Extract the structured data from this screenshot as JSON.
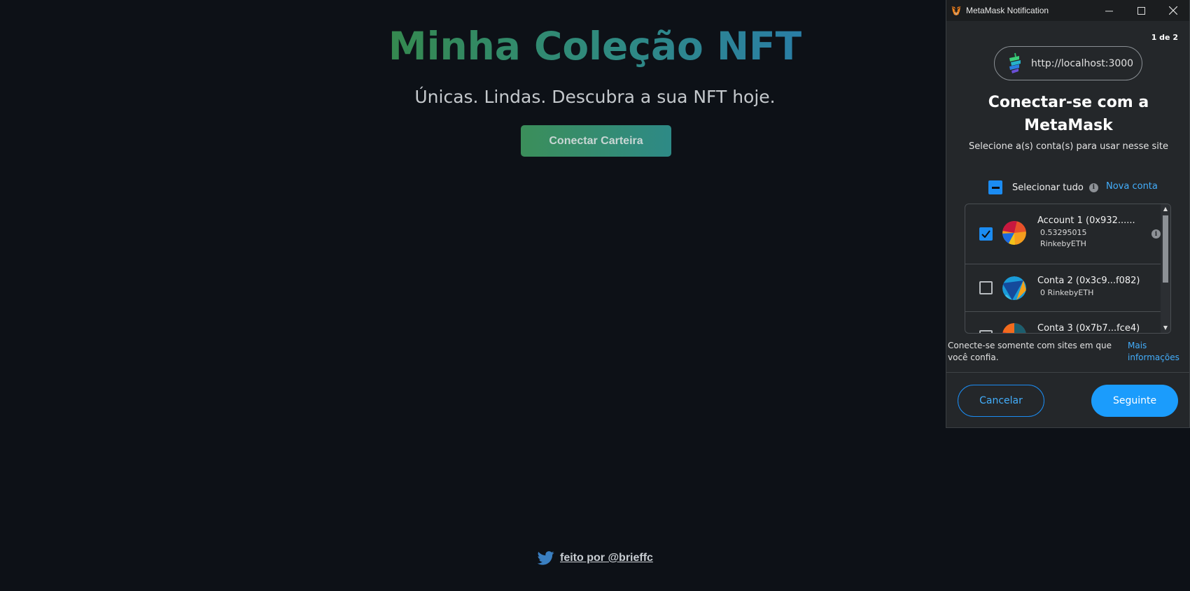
{
  "page": {
    "title": "Minha Coleção NFT",
    "subtitle": "Únicas. Lindas. Descubra a sua NFT hoje.",
    "connect_button": "Conectar Carteira",
    "footer_link": "feito por @brieffc ",
    "footer_icon": "twitter-icon"
  },
  "popup": {
    "window_title": "MetaMask Notification",
    "window_icon": "metamask-fox-icon",
    "page_counter": "1 de 2",
    "origin": "http://localhost:3000",
    "heading": "Conectar-se com a MetaMask",
    "subheading": "Selecione a(s) conta(s) para usar nesse site",
    "select_all_label": "Selecionar tudo",
    "new_account_link": "Nova conta",
    "accounts": [
      {
        "name": "Account 1 (0x932......",
        "balance_line1": "0.53295015",
        "balance_line2": "RinkebyETH",
        "checked": true
      },
      {
        "name": "Conta 2 (0x3c9...f082)",
        "balance_line1": "0 RinkebyETH",
        "balance_line2": "",
        "checked": false
      },
      {
        "name": "Conta 3 (0x7b7...fce4)",
        "balance_line1": "",
        "balance_line2": "",
        "checked": false
      }
    ],
    "trust_note": "Conecte-se somente com sites em que você confia.",
    "more_info_link": "Mais informações",
    "cancel_button": "Cancelar",
    "next_button": "Seguinte"
  },
  "colors": {
    "background": "#0d1117",
    "title_gradient_start": "#35894f",
    "title_gradient_end": "#2a7ea6",
    "metamask_blue": "#1b9cfc",
    "popup_bg": "#24272a"
  }
}
